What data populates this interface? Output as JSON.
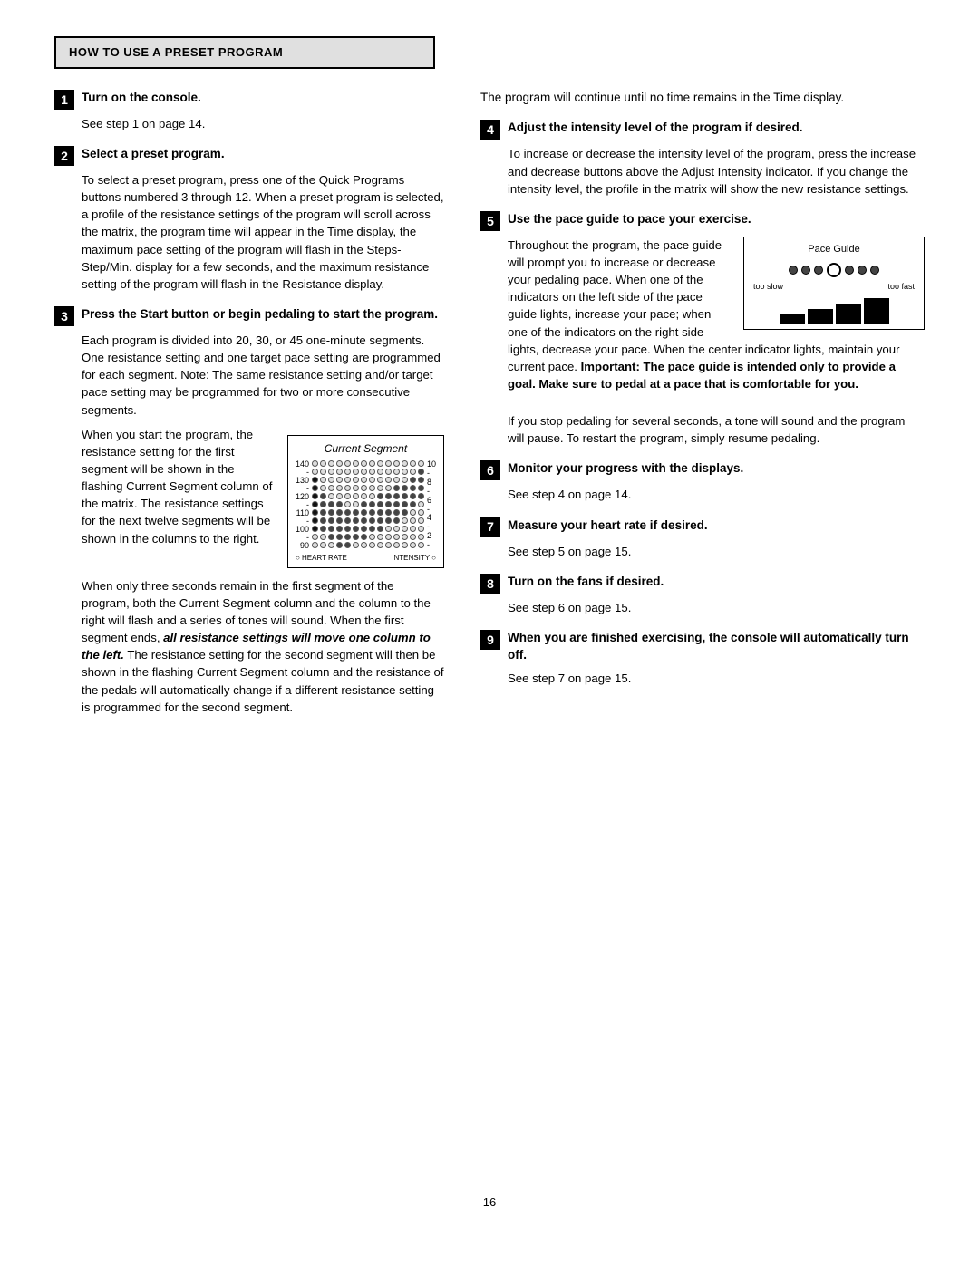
{
  "header": {
    "title": "HOW TO USE A PRESET PROGRAM"
  },
  "left_col": {
    "step1": {
      "number": "1",
      "title": "Turn on the console.",
      "body": "See step 1 on page 14."
    },
    "step2": {
      "number": "2",
      "title": "Select a preset program.",
      "body": "To select a preset program, press one of the Quick Programs buttons numbered 3 through 12. When a preset program is selected, a profile of the resistance settings of the program will scroll across the matrix, the program time will appear in the Time display, the maximum pace setting of the program will flash in the Steps-Step/Min. display for a few seconds, and the maximum resistance setting of the program will flash in the Resistance display."
    },
    "step3": {
      "number": "3",
      "title": "Press the Start button or begin pedaling to start the program.",
      "body1": "Each program is divided into 20, 30, or 45 one-minute segments. One resistance setting and one target pace setting are programmed for each segment. Note: The same resistance setting and/or target pace setting may be programmed for two or more consecutive segments.",
      "body2": "When you start the program, the resistance setting for the first segment will be shown in the flashing Current Segment column of the matrix. The resistance settings for the next twelve segments will be shown in the columns to the right.",
      "matrix_title": "Current Segment",
      "body3": "When only three seconds remain in the first segment of the program, both the Current Segment column and the column to the right will flash and a series of tones will sound. When the first segment ends, ",
      "italic_text": "all resistance settings will move one column to the left.",
      "body4": " The resistance setting for the second segment will then be shown in the flashing Current Segment column and the resistance of the pedals will automatically change if a different resistance setting is programmed for the second segment."
    }
  },
  "right_col": {
    "intro": {
      "body": "The program will continue until no time remains in the Time display."
    },
    "step4": {
      "number": "4",
      "title": "Adjust the intensity level of the program if desired.",
      "body": "To increase or decrease the intensity level of the program, press the increase and decrease buttons above the Adjust Intensity indicator. If you change the intensity level, the profile in the matrix will show the new resistance settings."
    },
    "step5": {
      "number": "5",
      "title": "Use the pace guide to pace your exercise.",
      "body1": "Throughout the program, the pace guide will prompt you to increase or decrease your pedaling pace. When one of the indicators on the left side of the pace guide lights, increase your pace; when one of the indicators on the right side lights, decrease your pace. When the center indicator lights, maintain your current pace. ",
      "bold_text": "Important: The pace guide is intended only to provide a goal. Make sure to pedal at a pace that is comfortable for you.",
      "pace_title": "Pace Guide",
      "pace_label_left": "too slow",
      "pace_label_right": "too fast"
    },
    "step5b": {
      "body": "If you stop pedaling for several seconds, a tone will sound and the program will pause. To restart the program, simply resume pedaling."
    },
    "step6": {
      "number": "6",
      "title": "Monitor your progress with the displays.",
      "body": "See step 4 on page 14."
    },
    "step7": {
      "number": "7",
      "title": "Measure your heart rate if desired.",
      "body": "See step 5 on page 15."
    },
    "step8": {
      "number": "8",
      "title": "Turn on the fans if desired.",
      "body": "See step 6 on page 15."
    },
    "step9": {
      "number": "9",
      "title": "When you are finished exercising, the console will automatically turn off.",
      "body": "See step 7 on page 15."
    }
  },
  "page_number": "16"
}
